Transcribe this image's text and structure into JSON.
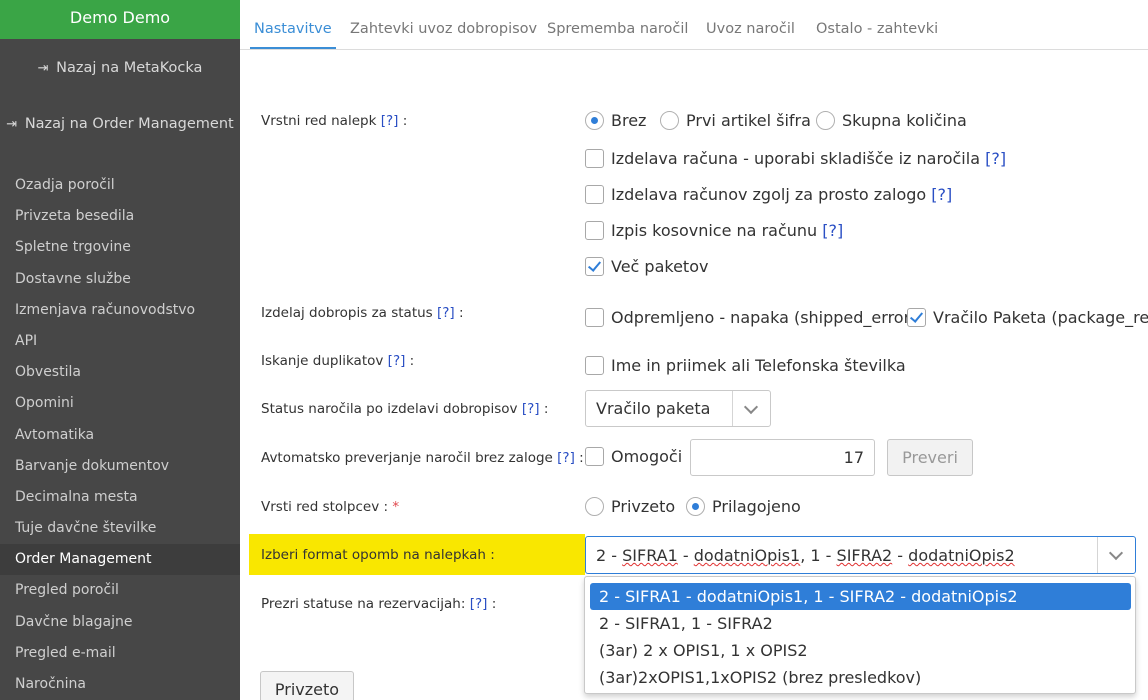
{
  "sidebar": {
    "brand": "Demo Demo",
    "back_links": [
      "Nazaj na MetaKocka",
      "Nazaj na Order Management"
    ],
    "items": [
      "Ozadja poročil",
      "Privzeta besedila",
      "Spletne trgovine",
      "Dostavne službe",
      "Izmenjava računovodstvo",
      "API",
      "Obvestila",
      "Opomini",
      "Avtomatika",
      "Barvanje dokumentov",
      "Decimalna mesta",
      "Tuje davčne številke",
      "Order Management",
      "Pregled poročil",
      "Davčne blagajne",
      "Pregled e-mail",
      "Naročnina"
    ],
    "active_item": "Order Management"
  },
  "tabs": [
    "Nastavitve",
    "Zahtevki uvoz dobropisov",
    "Sprememba naročil",
    "Uvoz naročil",
    "Ostalo - zahtevki"
  ],
  "active_tab": "Nastavitve",
  "help_marker": "[?]",
  "required_marker": "*",
  "form": {
    "label_order": {
      "label": "Vrstni red nalepk",
      "options": [
        "Brez",
        "Prvi artikel šifra",
        "Skupna količina"
      ],
      "selected": "Brez"
    },
    "checkboxes": [
      {
        "label": "Izdelava računa - uporabi skladišče iz naročila",
        "checked": false
      },
      {
        "label": "Izdelava računov zgolj za prosto zalogo",
        "checked": false
      },
      {
        "label": "Izpis kosovnice na računu",
        "checked": false
      },
      {
        "label": "Več paketov",
        "checked": true
      }
    ],
    "credit_note_status": {
      "label": "Izdelaj dobropis za status",
      "options": [
        {
          "label": "Odpremljeno - napaka (shipped_error)",
          "checked": false
        },
        {
          "label": "Vračilo Paketa (package_retur",
          "checked": true
        }
      ]
    },
    "duplicates": {
      "label": "Iskanje duplikatov",
      "option": "Ime in priimek ali Telefonska številka",
      "checked": false
    },
    "order_status": {
      "label": "Status naročila po izdelavi dobropisov",
      "value": "Vračilo paketa"
    },
    "auto_check": {
      "label": "Avtomatsko preverjanje naročil brez zaloge",
      "option": "Omogoči",
      "checked": false,
      "value": "17",
      "button": "Preveri"
    },
    "column_order": {
      "label": "Vrsti red stolpcev :",
      "options": [
        "Privzeto",
        "Prilagojeno"
      ],
      "selected": "Prilagojeno"
    },
    "note_format": {
      "label": "Izberi format opomb na nalepkah :",
      "value_parts": [
        "2 - ",
        "SIFRA1",
        " - ",
        "dodatniOpis1",
        ", 1 - ",
        "SIFRA2",
        " - ",
        "dodatniOpis2"
      ],
      "options": [
        "2 - SIFRA1 - dodatniOpis1, 1 - SIFRA2 - dodatniOpis2",
        "2 - SIFRA1, 1 - SIFRA2",
        "(3ar) 2 x OPIS1, 1 x OPIS2",
        "(3ar)2xOPIS1,1xOPIS2 (brez presledkov)"
      ],
      "selected_index": 0
    },
    "ignore_status": {
      "label": "Prezri statuse na rezervacijah:"
    },
    "default_button": "Privzeto"
  },
  "colors": {
    "sidebar_bg": "#474747",
    "brand_green": "#3aa546",
    "accent_blue": "#2f7ed8",
    "highlight_yellow": "#f9e700"
  }
}
